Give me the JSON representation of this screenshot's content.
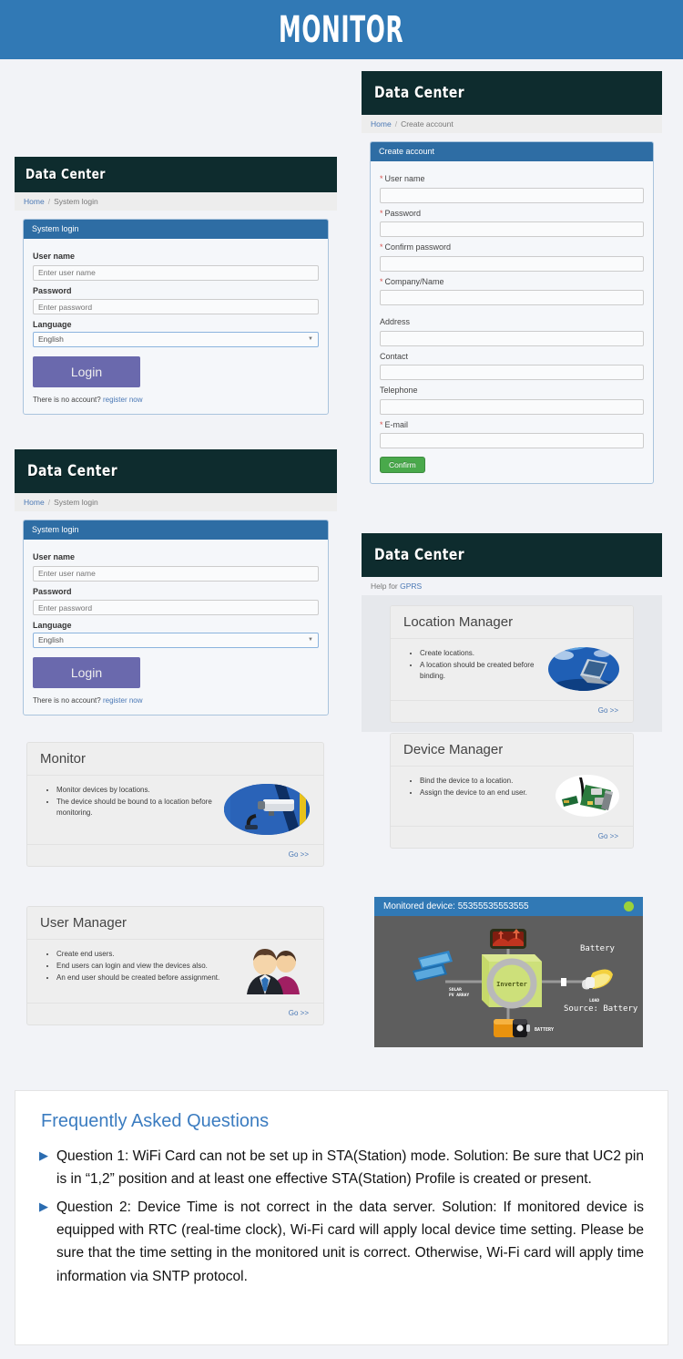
{
  "banner": {
    "title": "MONITOR"
  },
  "brand": "Data Center",
  "login_panel": {
    "breadcrumb": {
      "home": "Home",
      "sep": "/",
      "current": "System login"
    },
    "panel_title": "System login",
    "username_label": "User name",
    "username_placeholder": "Enter user name",
    "password_label": "Password",
    "password_placeholder": "Enter password",
    "language_label": "Language",
    "language_value": "English",
    "login_button": "Login",
    "no_account_text": "There is no account?",
    "register_link": "register now"
  },
  "create_account": {
    "breadcrumb": {
      "home": "Home",
      "sep": "/",
      "current": "Create account"
    },
    "panel_title": "Create account",
    "fields": [
      {
        "label": "User name",
        "required": true
      },
      {
        "label": "Password",
        "required": true
      },
      {
        "label": "Confirm password",
        "required": true
      },
      {
        "label": "Company/Name",
        "required": true
      },
      {
        "label": "Address",
        "required": false
      },
      {
        "label": "Contact",
        "required": false
      },
      {
        "label": "Telephone",
        "required": false
      },
      {
        "label": "E-mail",
        "required": true
      }
    ],
    "confirm_button": "Confirm"
  },
  "help": {
    "prefix": "Help for",
    "link": "GPRS"
  },
  "cards": {
    "monitor": {
      "title": "Monitor",
      "bullets": [
        "Monitor devices by locations.",
        "The device should be bound to a location before monitoring."
      ],
      "go": "Go >>",
      "icon": "security-camera-icon"
    },
    "user_manager": {
      "title": "User Manager",
      "bullets": [
        "Create end users.",
        "End users can login and view the devices also.",
        "An end user should be created before assignment."
      ],
      "go": "Go >>",
      "icon": "users-icon"
    },
    "location_manager": {
      "title": "Location Manager",
      "bullets": [
        "Create locations.",
        "A location should be created before binding."
      ],
      "go": "Go >>",
      "icon": "laptop-cloud-icon"
    },
    "device_manager": {
      "title": "Device Manager",
      "bullets": [
        "Bind the device to a location.",
        "Assign the device to an end user."
      ],
      "go": "Go >>",
      "icon": "wifi-card-icon"
    }
  },
  "device_monitor": {
    "title": "Monitored device: 55355535553555",
    "status_color": "#9cd139",
    "labels": {
      "solar": "SOLAR\nPV ARRAY",
      "inverter": "Inverter",
      "battery_small": "BATTERY",
      "load": "LOAD",
      "battery_right": "Battery",
      "source": "Source: Battery"
    }
  },
  "faq": {
    "title": "Frequently Asked Questions",
    "items": [
      "Question 1: WiFi Card can not be set up in STA(Station) mode. Solution: Be sure that UC2 pin is in “1,2” position and at least one effective STA(Station) Profile is created or present.",
      "Question 2: Device Time is not correct in the data server. Solution: If monitored device is equipped with RTC (real-time clock), Wi-Fi card will apply local device time setting. Please be sure that the time setting in the monitored unit is correct. Otherwise, Wi-Fi card will apply time information via SNTP protocol."
    ]
  },
  "colors": {
    "banner_blue": "#3179b5",
    "navbar_dark": "#0e2c2e",
    "panel_blue": "#2e6da4",
    "login_purple": "#6a69ad",
    "confirm_green": "#49a94b",
    "link_blue": "#4a78b5",
    "page_bg": "#f2f3f7"
  }
}
